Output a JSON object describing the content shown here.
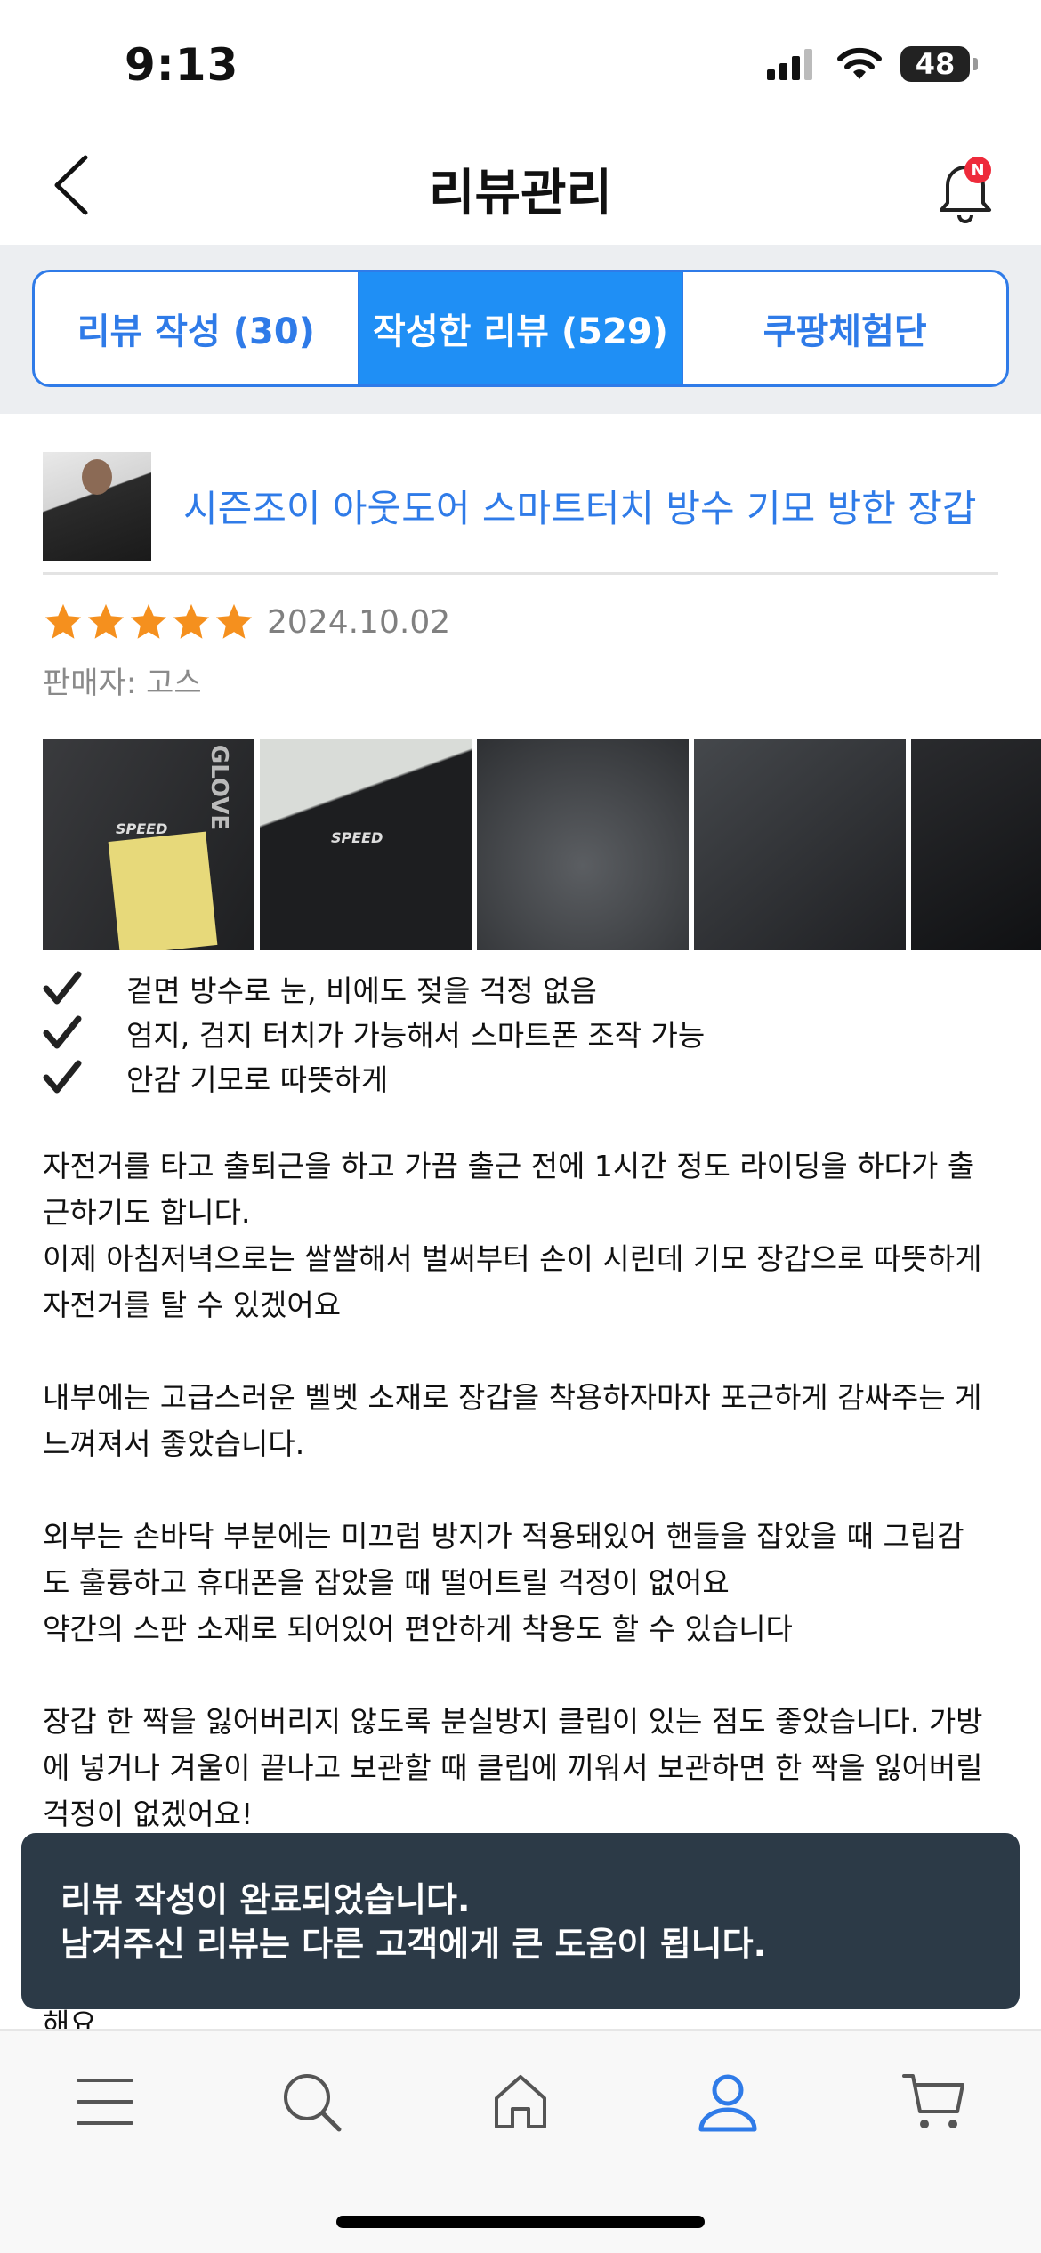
{
  "status_bar": {
    "time": "9:13",
    "battery": "48"
  },
  "header": {
    "title": "리뷰관리",
    "notification_badge": "N"
  },
  "tabs": [
    {
      "label": "리뷰 작성 (30)",
      "active": false
    },
    {
      "label": "작성한 리뷰 (529)",
      "active": true
    },
    {
      "label": "쿠팡체험단",
      "active": false
    }
  ],
  "product": {
    "name": "시즌조이 아웃도어 스마트터치 방수 기모 방한 장갑"
  },
  "review": {
    "rating": 5,
    "date": "2024.10.02",
    "seller": "판매자: 고스",
    "photo_labels": [
      "SPEED",
      "GLOVE",
      "SPEED"
    ],
    "checks": [
      "겉면 방수로 눈, 비에도 젖을 걱정 없음",
      "엄지, 검지 터치가 가능해서 스마트폰 조작 가능",
      "안감 기모로 따뜻하게"
    ],
    "paragraphs": [
      "자전거를 타고 출퇴근을 하고 가끔 출근 전에 1시간 정도 라이딩을 하다가 출\n근하기도 합니다.\n이제 아침저녁으로는 쌀쌀해서 벌써부터 손이 시린데 기모 장갑으로 따뜻하게\n자전거를 탈 수 있겠어요",
      "내부에는 고급스러운 벨벳 소재로 장갑을 착용하자마자 포근하게 감싸주는 게\n느껴져서 좋았습니다.",
      "외부는 손바닥 부분에는 미끄럼 방지가 적용돼있어 핸들을 잡았을 때 그립감\n도 훌륭하고 휴대폰을 잡았을 때 떨어트릴 걱정이 없어요\n약간의 스판 소재로 되어있어 편안하게 착용도 할 수 있습니다",
      "장갑 한 짝을 잃어버리지 않도록 분실방지 클립이 있는 점도 좋았습니다. 가방\n에 넣거나 겨울이 끝나고 보관할 때 클립에 끼워서 보관하면 한 짝을 잃어버릴\n걱정이 없겠어요!"
    ],
    "cut_text": "해요"
  },
  "toast": {
    "line1": "리뷰 작성이 완료되었습니다.",
    "line2": "남겨주신 리뷰는 다른 고객에게 큰 도움이 됩니다."
  },
  "bottom_nav": {
    "items": [
      "menu-icon",
      "search-icon",
      "home-icon",
      "my-account-icon",
      "cart-icon"
    ],
    "active": "my-account-icon"
  },
  "colors": {
    "accent": "#2f7be8",
    "active_tab": "#1f8ff5",
    "star": "#f5901e",
    "toast": "#2c3a47"
  }
}
